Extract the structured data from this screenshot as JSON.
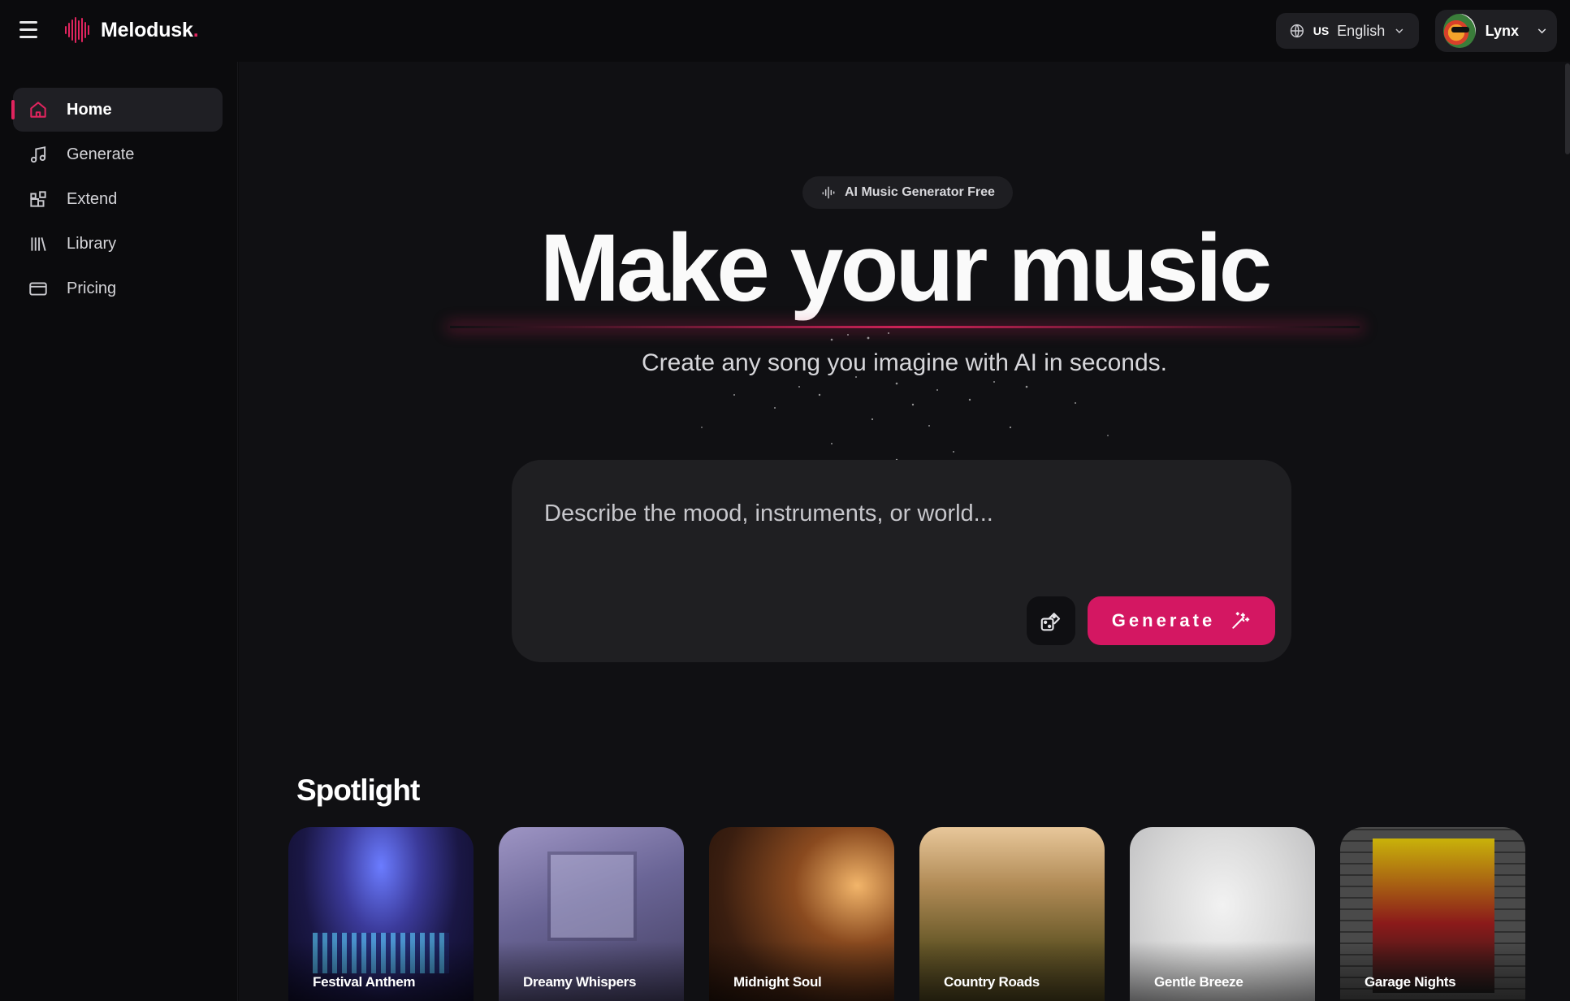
{
  "app": {
    "name": "Melodusk",
    "name_suffix": "."
  },
  "header": {
    "language": {
      "flag": "US",
      "label": "English"
    },
    "user": {
      "name": "Lynx"
    }
  },
  "sidebar": {
    "items": [
      {
        "label": "Home",
        "icon": "home-icon",
        "active": true
      },
      {
        "label": "Generate",
        "icon": "music-note-icon",
        "active": false
      },
      {
        "label": "Extend",
        "icon": "extend-icon",
        "active": false
      },
      {
        "label": "Library",
        "icon": "library-icon",
        "active": false
      },
      {
        "label": "Pricing",
        "icon": "credit-card-icon",
        "active": false
      }
    ]
  },
  "hero": {
    "badge": "AI Music Generator Free",
    "title": "Make your music",
    "subtitle": "Create any song you imagine with AI in seconds."
  },
  "prompt": {
    "placeholder": "Describe the mood, instruments, or world...",
    "value": "",
    "generate_label": "Generate"
  },
  "spotlight": {
    "title": "Spotlight",
    "cards": [
      {
        "title": "Festival Anthem"
      },
      {
        "title": "Dreamy Whispers"
      },
      {
        "title": "Midnight Soul"
      },
      {
        "title": "Country Roads"
      },
      {
        "title": "Gentle Breeze"
      },
      {
        "title": "Garage Nights"
      }
    ]
  },
  "colors": {
    "accent": "#d41762",
    "background": "#101013",
    "panel": "#1f1f22"
  }
}
